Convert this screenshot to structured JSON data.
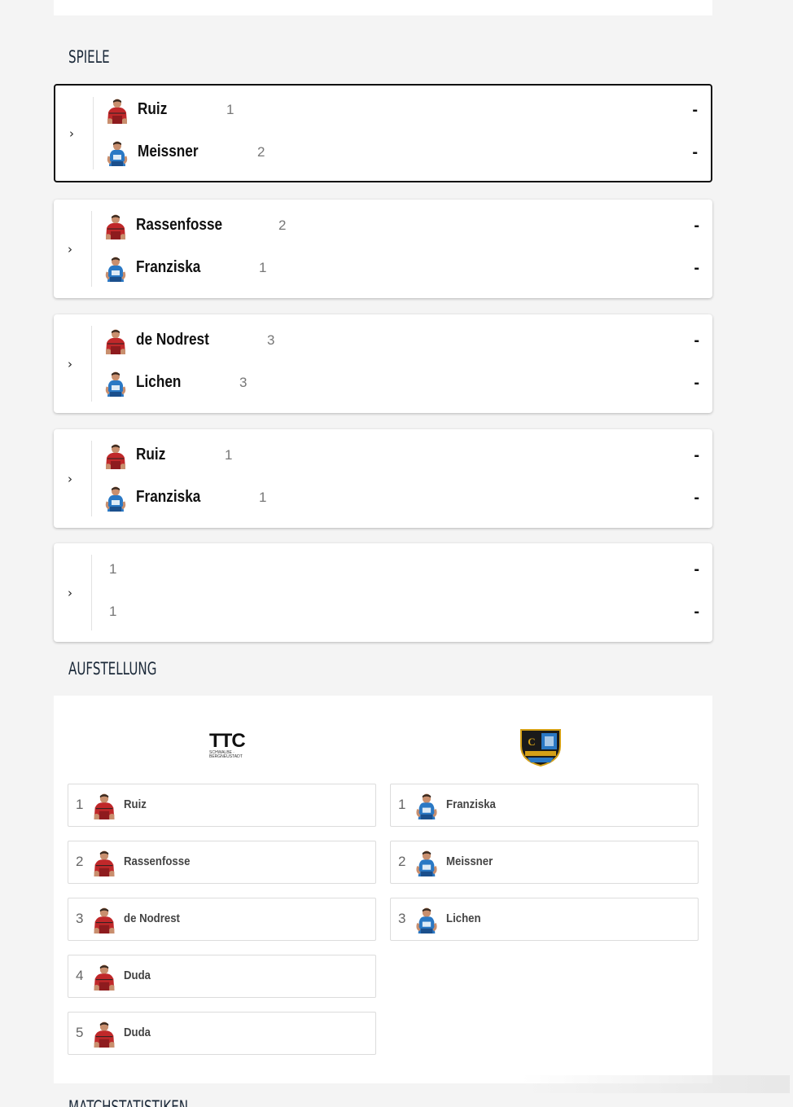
{
  "sections": {
    "games_title": "SPIELE",
    "lineup_title": "AUFSTELLUNG",
    "stats_title": "MATCHSTATISTIKEN"
  },
  "matches": [
    {
      "home": {
        "name": "Ruiz",
        "seed": "1",
        "score": "-"
      },
      "away": {
        "name": "Meissner",
        "seed": "2",
        "score": "-"
      }
    },
    {
      "home": {
        "name": "Rassenfosse",
        "seed": "2",
        "score": "-"
      },
      "away": {
        "name": "Franziska",
        "seed": "1",
        "score": "-"
      }
    },
    {
      "home": {
        "name": "de Nodrest",
        "seed": "3",
        "score": "-"
      },
      "away": {
        "name": "Lichen",
        "seed": "3",
        "score": "-"
      }
    },
    {
      "home": {
        "name": "Ruiz",
        "seed": "1",
        "score": "-"
      },
      "away": {
        "name": "Franziska",
        "seed": "1",
        "score": "-"
      }
    },
    {
      "home": {
        "name": "",
        "seed": "1",
        "score": "-"
      },
      "away": {
        "name": "",
        "seed": "1",
        "score": "-"
      }
    }
  ],
  "lineup": {
    "home_logo_text": "TTC",
    "home_logo_sub": "SCHWALBE · BERGNEUSTADT",
    "home": [
      {
        "num": "1",
        "name": "Ruiz"
      },
      {
        "num": "2",
        "name": "Rassenfosse"
      },
      {
        "num": "3",
        "name": "de Nodrest"
      },
      {
        "num": "4",
        "name": "Duda"
      },
      {
        "num": "5",
        "name": "Duda"
      }
    ],
    "away": [
      {
        "num": "1",
        "name": "Franziska"
      },
      {
        "num": "2",
        "name": "Meissner"
      },
      {
        "num": "3",
        "name": "Lichen"
      }
    ]
  },
  "colors": {
    "home_jersey": "#c0282a",
    "away_jersey": "#2a78c4",
    "heading": "#1c2a3a"
  },
  "icons": {
    "expand": "chevron-right-icon",
    "home_avatar": "player-red-jersey-icon",
    "away_avatar": "player-blue-jersey-icon"
  }
}
